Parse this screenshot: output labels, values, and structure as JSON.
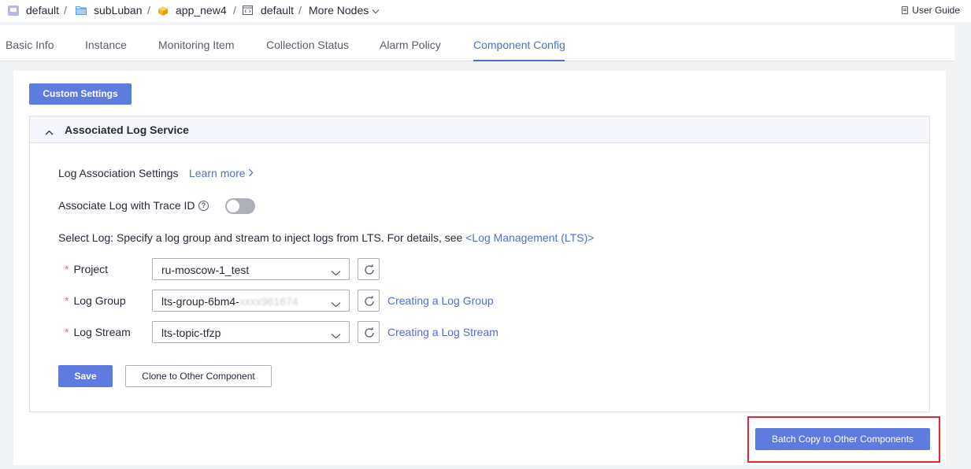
{
  "breadcrumb": {
    "items": [
      {
        "label": "default",
        "icon": "application-icon"
      },
      {
        "label": "subLuban",
        "icon": "folder-icon"
      },
      {
        "label": "app_new4",
        "icon": "cube-icon"
      },
      {
        "label": "default",
        "icon": "code-window-icon"
      }
    ],
    "separator": "/",
    "more_nodes": "More Nodes"
  },
  "user_guide": "User Guide",
  "tabs": [
    {
      "label": "Basic Info",
      "active": false
    },
    {
      "label": "Instance",
      "active": false
    },
    {
      "label": "Monitoring Item",
      "active": false
    },
    {
      "label": "Collection Status",
      "active": false
    },
    {
      "label": "Alarm Policy",
      "active": false
    },
    {
      "label": "Component Config",
      "active": true
    }
  ],
  "custom_settings_label": "Custom Settings",
  "panel": {
    "title": "Associated Log Service",
    "expanded": true,
    "log_assoc_label": "Log Association Settings",
    "learn_more": "Learn more",
    "trace_label": "Associate Log with Trace ID",
    "trace_enabled": false,
    "select_log_text": "Select Log: Specify a log group and stream to inject logs from LTS. For details, see",
    "lts_link": "<Log Management (LTS)>",
    "required_mark": "*",
    "fields": {
      "project": {
        "label": "Project",
        "value": "ru-moscow-1_test"
      },
      "log_group": {
        "label": "Log Group",
        "value_prefix": "lts-group-6bm4-",
        "value_obscured": "xxxx961674",
        "create_link": "Creating a Log Group"
      },
      "log_stream": {
        "label": "Log Stream",
        "value": "lts-topic-tfzp",
        "create_link": "Creating a Log Stream"
      }
    },
    "save_label": "Save",
    "clone_label": "Clone to Other Component"
  },
  "batch_copy_label": "Batch Copy to Other Components",
  "colors": {
    "primary": "#5e7ce0",
    "link": "#526ecc",
    "required": "#f66f6a",
    "highlight": "#e8262e",
    "toggle_off": "#adb0b8"
  }
}
